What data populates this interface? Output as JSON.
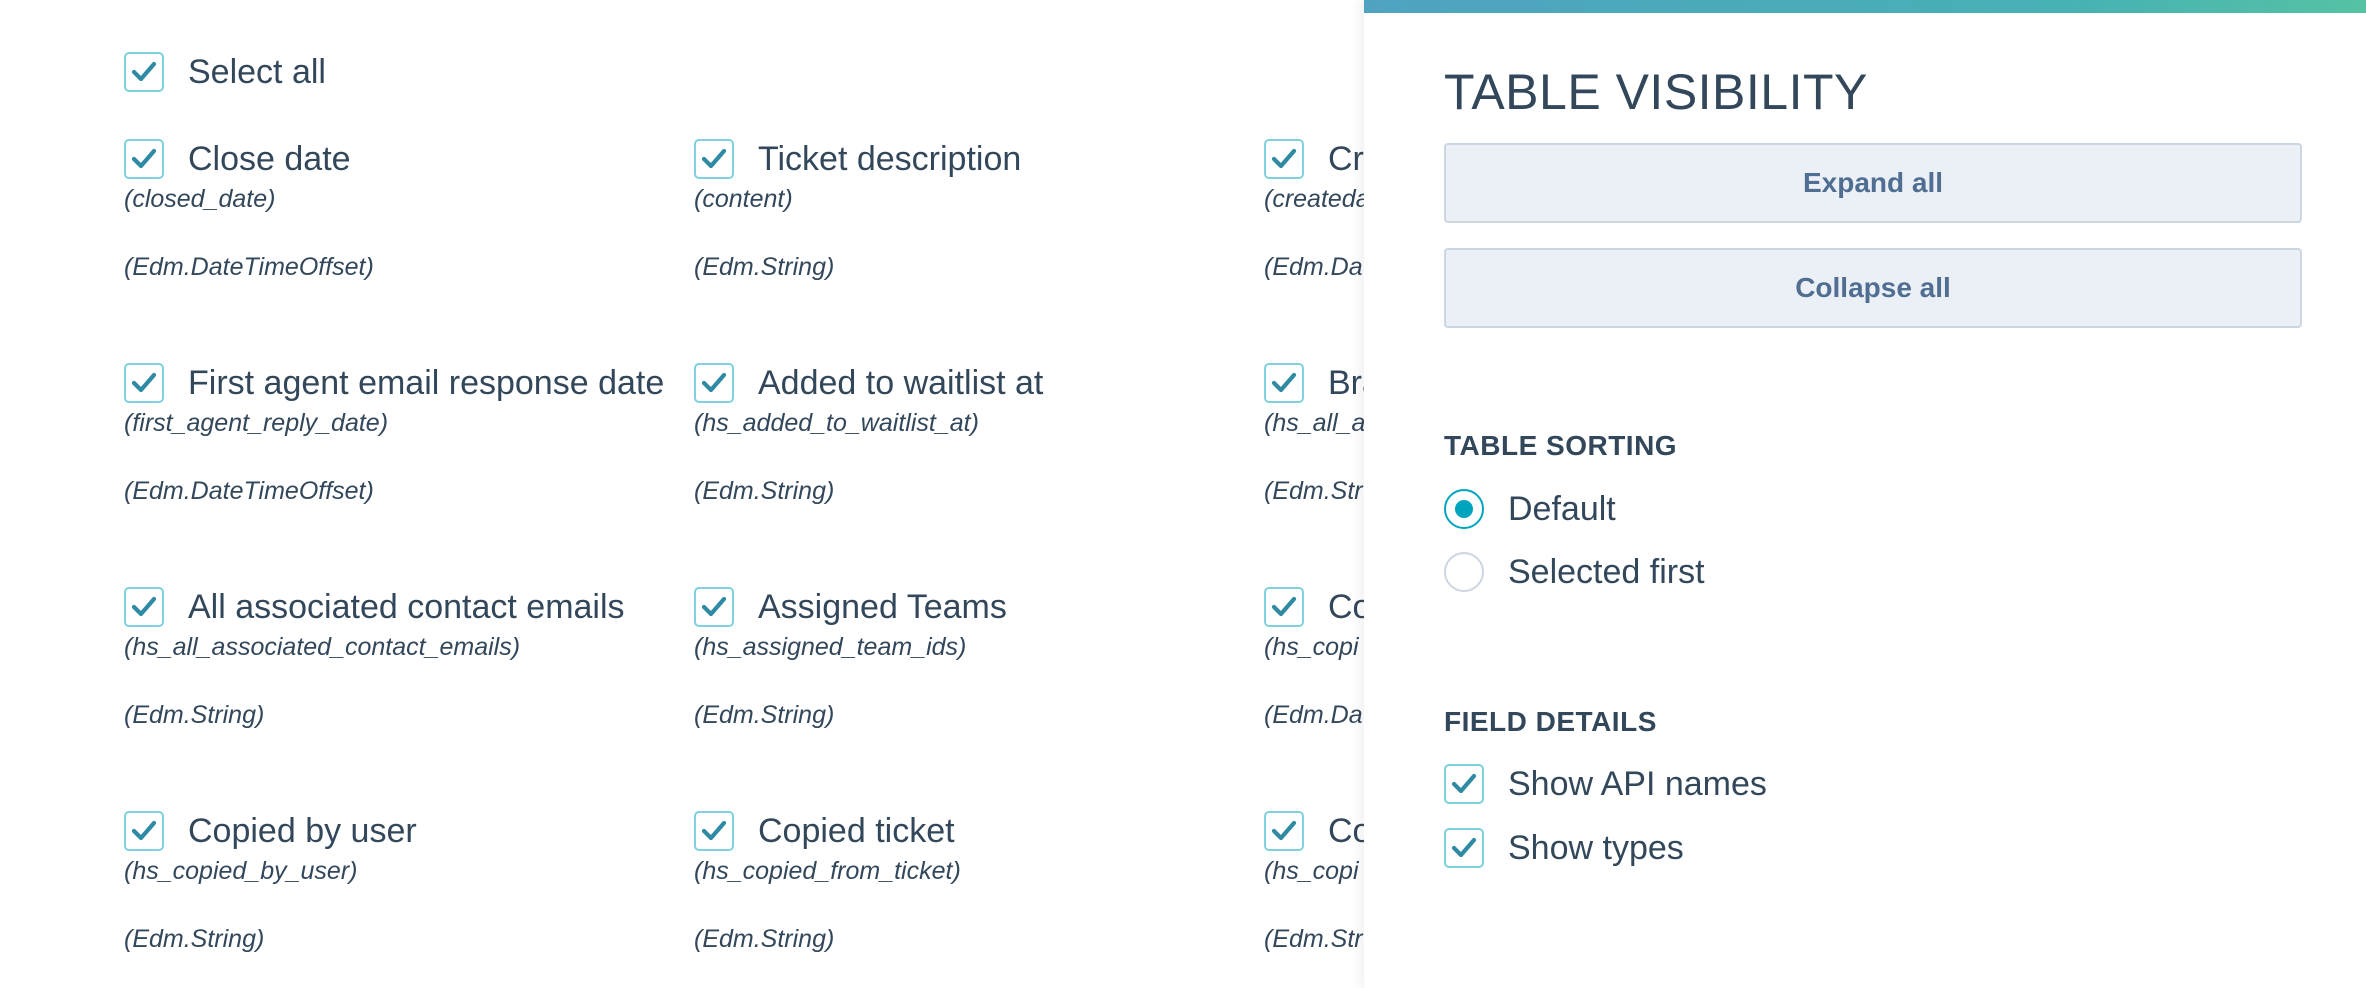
{
  "fields_list": {
    "select_all": {
      "label": "Select all",
      "checked": true
    },
    "items": [
      {
        "label": "Close date",
        "api": "(closed_date)",
        "type": "(Edm.DateTimeOffset)",
        "checked": true
      },
      {
        "label": "Ticket description",
        "api": "(content)",
        "type": "(Edm.String)",
        "checked": true
      },
      {
        "label": "Cre",
        "api": "(createda",
        "type": "(Edm.Da",
        "checked": true
      },
      {
        "label": "First agent email response date",
        "api": "(first_agent_reply_date)",
        "type": "(Edm.DateTimeOffset)",
        "checked": true
      },
      {
        "label": "Added to waitlist at",
        "api": "(hs_added_to_waitlist_at)",
        "type": "(Edm.String)",
        "checked": true
      },
      {
        "label": "Bra",
        "api": "(hs_all_a",
        "type": "(Edm.Str",
        "checked": true
      },
      {
        "label": "All associated contact emails",
        "api": "(hs_all_associated_contact_emails)",
        "type": "(Edm.String)",
        "checked": true
      },
      {
        "label": "Assigned Teams",
        "api": "(hs_assigned_team_ids)",
        "type": "(Edm.String)",
        "checked": true
      },
      {
        "label": "Co",
        "api": "(hs_copi",
        "type": "(Edm.Da",
        "checked": true
      },
      {
        "label": "Copied by user",
        "api": "(hs_copied_by_user)",
        "type": "(Edm.String)",
        "checked": true
      },
      {
        "label": "Copied ticket",
        "api": "(hs_copied_from_ticket)",
        "type": "(Edm.String)",
        "checked": true
      },
      {
        "label": "Co",
        "api": "(hs_copi",
        "type": "(Edm.Str",
        "checked": true
      }
    ]
  },
  "panel": {
    "title": "TABLE VISIBILITY",
    "expand_all": "Expand all",
    "collapse_all": "Collapse all",
    "sorting": {
      "heading": "TABLE SORTING",
      "options": [
        {
          "label": "Default",
          "selected": true
        },
        {
          "label": "Selected first",
          "selected": false
        }
      ]
    },
    "details": {
      "heading": "FIELD DETAILS",
      "options": [
        {
          "label": "Show API names",
          "checked": true
        },
        {
          "label": "Show types",
          "checked": true
        }
      ]
    }
  },
  "colors": {
    "text": "#33475b",
    "checkbox_border": "#7fd1de",
    "check_mark": "#2f8aa3",
    "radio_accent": "#00a4bd",
    "button_bg": "#eaf0f6",
    "button_text": "#506e91",
    "accent_bar": "#4fa3c0"
  }
}
